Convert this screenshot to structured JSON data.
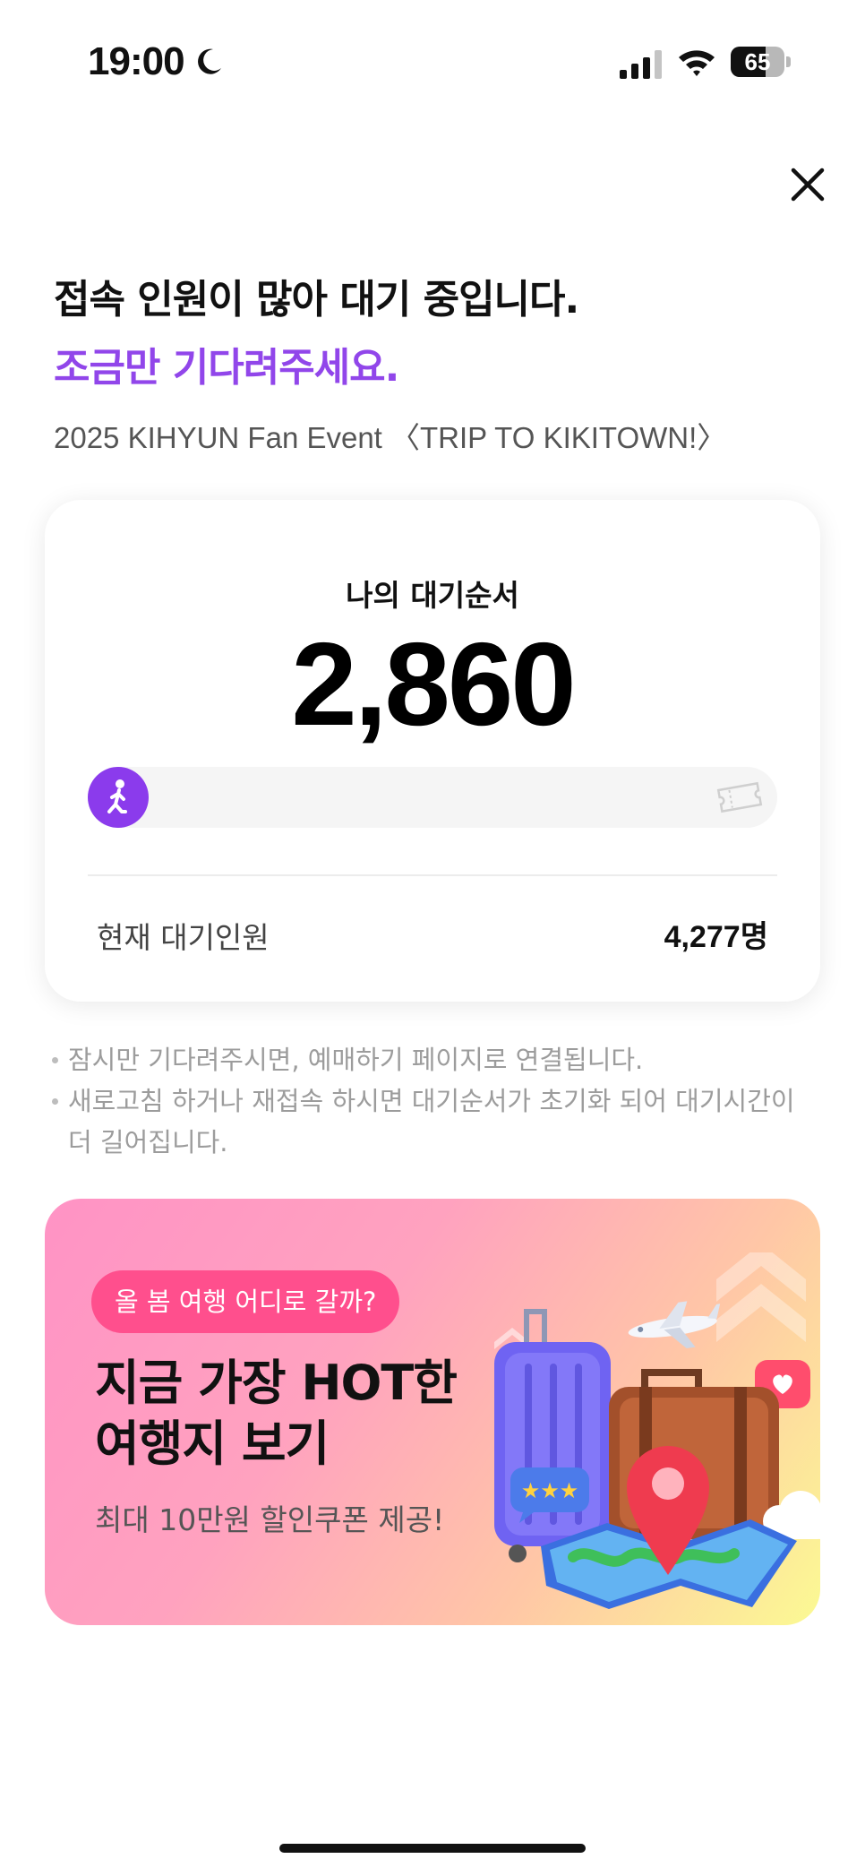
{
  "status_bar": {
    "time": "19:00",
    "battery_percent": "65",
    "battery_level": 0.65,
    "icons": [
      "moon-icon",
      "signal-icon",
      "wifi-icon",
      "battery-icon"
    ]
  },
  "header": {
    "close_icon": "close-icon",
    "title": "접속 인원이 많아 대기 중입니다.",
    "subtitle": "조금만 기다려주세요.",
    "event_name": "2025 KIHYUN Fan Event 〈TRIP TO KIKITOWN!〉"
  },
  "queue": {
    "label": "나의 대기순서",
    "position": "2,860",
    "progress": 0.0,
    "progress_start_icon": "walking-person-icon",
    "progress_end_icon": "ticket-icon",
    "current_waiting_label": "현재 대기인원",
    "current_waiting_value": "4,277명"
  },
  "notices": [
    "잠시만 기다려주시면, 예매하기 페이지로 연결됩니다.",
    "새로고침 하거나 재접속 하시면 대기순서가 초기화 되어 대기시간이 더 길어집니다."
  ],
  "banner": {
    "tag": "올 봄 여행 어디로 갈까?",
    "title_line1": "지금 가장 HOT한",
    "title_line2": "여행지 보기",
    "subtitle": "최대 10만원 할인쿠폰 제공!",
    "illustration": "travel-illustration-icon"
  },
  "colors": {
    "accent": "#9146ea",
    "tag": "#ff4f8d",
    "progress_icon_bg": "#8b3bec"
  }
}
